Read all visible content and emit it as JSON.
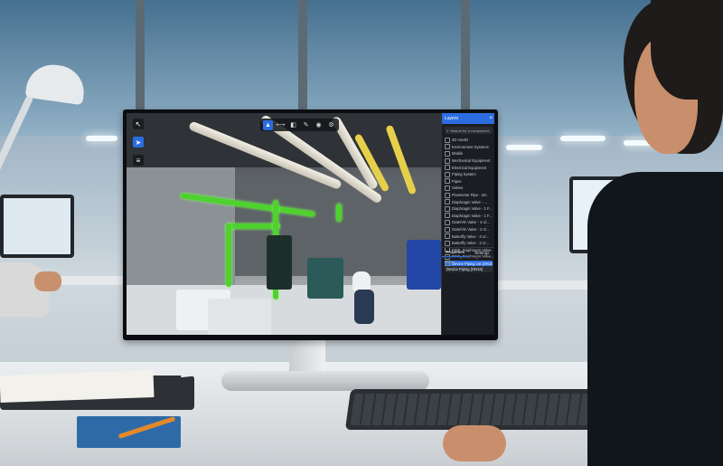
{
  "viewer": {
    "left_tools": [
      {
        "icon": "cursor-icon",
        "active": false
      },
      {
        "icon": "navigate-icon",
        "active": true
      },
      {
        "icon": "layers-icon",
        "active": false
      }
    ],
    "top_tools": [
      {
        "icon": "pointer-icon",
        "active": true
      },
      {
        "icon": "measure-icon",
        "active": false
      },
      {
        "icon": "section-icon",
        "active": false
      },
      {
        "icon": "annotate-icon",
        "active": false
      },
      {
        "icon": "camera-icon",
        "active": false
      },
      {
        "icon": "settings-icon",
        "active": false
      }
    ],
    "highlight_color": "#4fd12f",
    "accent_color": "#2b6de0"
  },
  "panel": {
    "title": "Layers",
    "search_placeholder": "Search for a component...",
    "tree_items": [
      {
        "label": "3D model",
        "selected": false
      },
      {
        "label": "Environment Systems",
        "selected": false
      },
      {
        "label": "Mobile",
        "selected": false
      },
      {
        "label": "Mechanical Equipment",
        "selected": false
      },
      {
        "label": "Electrical Equipment",
        "selected": false
      },
      {
        "label": "Piping System",
        "selected": false
      },
      {
        "label": "Pipes",
        "selected": false
      },
      {
        "label": "Valves",
        "selected": false
      },
      {
        "label": "Flowmeter Pipe - 2m",
        "selected": false
      },
      {
        "label": "Diaphragm Valve - ...",
        "selected": false
      },
      {
        "label": "Diaphragm Valve - 1 F...",
        "selected": false
      },
      {
        "label": "Diaphragm Valve - 1 F...",
        "selected": false
      },
      {
        "label": "Gate/Vlv Valve - 2-1/...",
        "selected": false
      },
      {
        "label": "Gate/Vlv Valve - 2-1/...",
        "selected": false
      },
      {
        "label": "Butterfly Valve - 3-1/...",
        "selected": false
      },
      {
        "label": "Butterfly Valve - 2-1/...",
        "selected": false
      },
      {
        "label": "Pitch_Diaphragm Valve...",
        "selected": false
      },
      {
        "label": "Pitch_Diaphragm Valve...",
        "selected": false
      },
      {
        "label": "Device Piping 1st (DN15)",
        "selected": true
      }
    ],
    "tabs": [
      "Properties",
      "Settings"
    ],
    "property_label": "Name",
    "property_value": "Device Piping (DN15)"
  }
}
